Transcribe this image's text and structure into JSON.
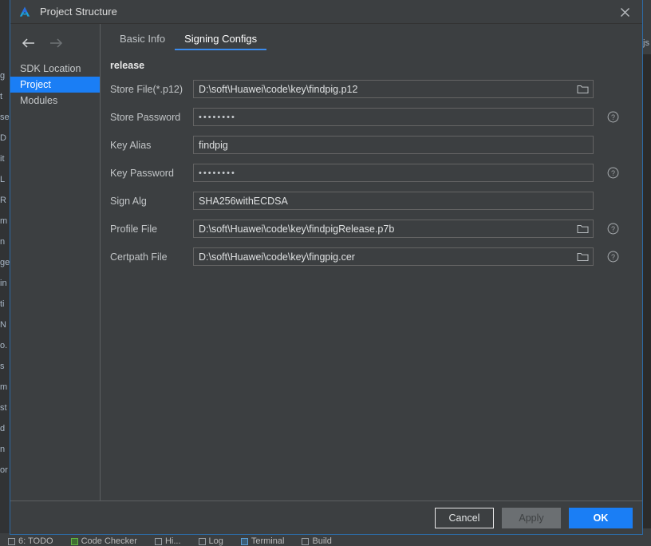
{
  "ide": {
    "left_fragments": [
      "g",
      "t",
      "se",
      "D",
      "it",
      "L",
      "R",
      "m",
      "n",
      "ge",
      "in",
      "ti",
      "N",
      "o.",
      "s",
      "m",
      "st",
      "d",
      "n",
      "or"
    ],
    "right_fragment": "js",
    "status_bar": [
      {
        "label": "6: TODO",
        "icon": "todo-icon"
      },
      {
        "label": "Code Checker",
        "icon": "code-checker-icon"
      },
      {
        "label": "Hi...",
        "icon": "hi-icon"
      },
      {
        "label": "Log",
        "icon": "log-icon"
      },
      {
        "label": "Terminal",
        "icon": "terminal-icon"
      },
      {
        "label": "Build",
        "icon": "build-icon"
      }
    ]
  },
  "dialog": {
    "title": "Project Structure",
    "logo_icon": "deveco-studio-logo",
    "close_icon": "close-icon"
  },
  "sidebar": {
    "back_icon": "arrow-left-icon",
    "forward_icon": "arrow-right-icon",
    "items": [
      {
        "label": "SDK Location",
        "selected": false
      },
      {
        "label": "Project",
        "selected": true
      },
      {
        "label": "Modules",
        "selected": false
      }
    ]
  },
  "main": {
    "tabs": [
      {
        "label": "Basic Info",
        "active": false
      },
      {
        "label": "Signing Configs",
        "active": true
      }
    ],
    "section_title": "release",
    "fields": [
      {
        "label": "Store File(*.p12)",
        "value": "D:\\soft\\Huawei\\code\\key\\findpig.p12",
        "type": "text",
        "browse": true,
        "help": false
      },
      {
        "label": "Store Password",
        "value": "••••••••",
        "type": "password",
        "browse": false,
        "help": true
      },
      {
        "label": "Key Alias",
        "value": "findpig",
        "type": "text",
        "browse": false,
        "help": false
      },
      {
        "label": "Key Password",
        "value": "••••••••",
        "type": "password",
        "browse": false,
        "help": true
      },
      {
        "label": "Sign Alg",
        "value": "SHA256withECDSA",
        "type": "text",
        "browse": false,
        "help": false
      },
      {
        "label": "Profile File",
        "value": "D:\\soft\\Huawei\\code\\key\\findpigRelease.p7b",
        "type": "text",
        "browse": true,
        "help": true
      },
      {
        "label": "Certpath File",
        "value": "D:\\soft\\Huawei\\code\\key\\fingpig.cer",
        "type": "text",
        "browse": true,
        "help": true
      }
    ]
  },
  "footer": {
    "cancel_label": "Cancel",
    "apply_label": "Apply",
    "ok_label": "OK"
  },
  "colors": {
    "accent_blue": "#1a7ef5",
    "tab_underline": "#3b8bed",
    "dialog_bg": "#3c3f41",
    "border": "#646464",
    "text": "#c2c5c7"
  }
}
